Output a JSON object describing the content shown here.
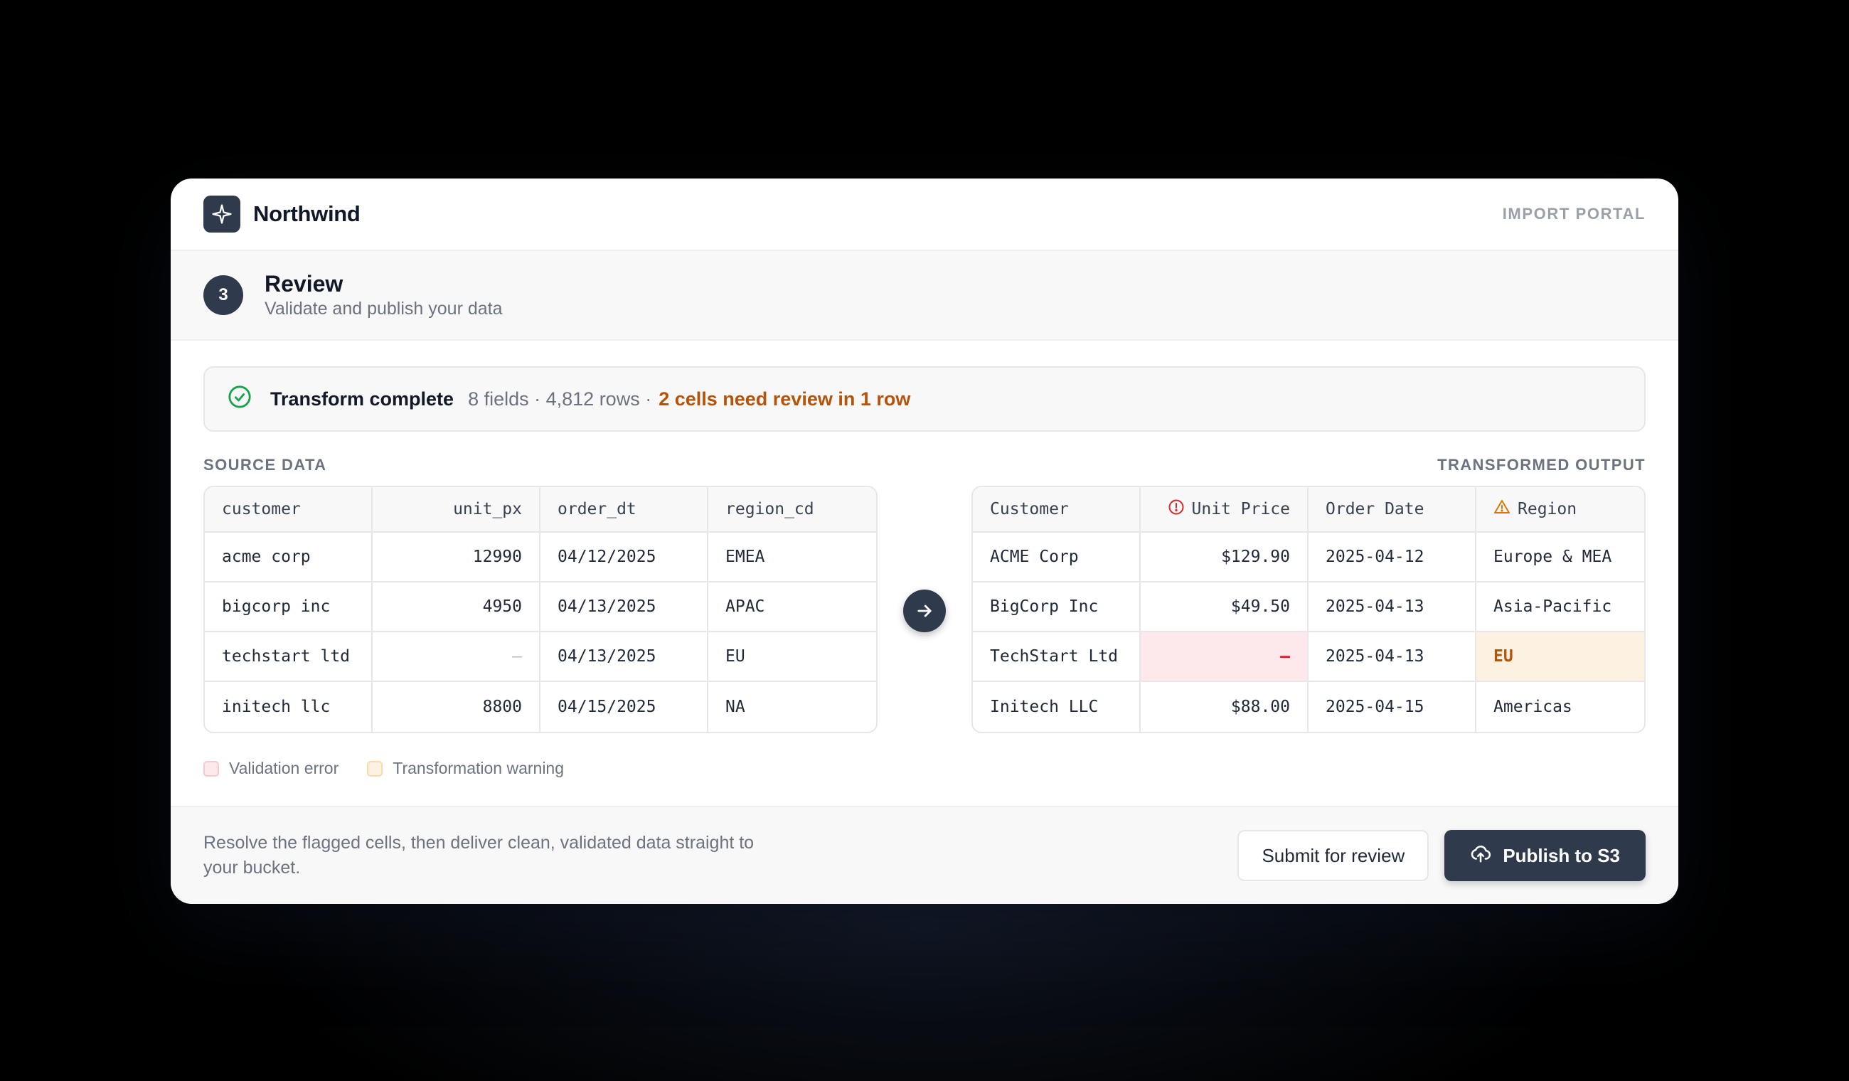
{
  "header": {
    "brand": "Northwind",
    "portal_label": "IMPORT PORTAL"
  },
  "step": {
    "number": "3",
    "title": "Review",
    "subtitle": "Validate and publish your data"
  },
  "status": {
    "title": "Transform complete",
    "meta": "8 fields · 4,812 rows ·",
    "warning": "2 cells need review in 1 row"
  },
  "sections": {
    "source_label": "SOURCE DATA",
    "output_label": "TRANSFORMED OUTPUT"
  },
  "source_table": {
    "headers": [
      "customer",
      "unit_px",
      "order_dt",
      "region_cd"
    ],
    "rows": [
      [
        "acme corp",
        "12990",
        "04/12/2025",
        "EMEA"
      ],
      [
        "bigcorp inc",
        "4950",
        "04/13/2025",
        "APAC"
      ],
      [
        "techstart ltd",
        "–",
        "04/13/2025",
        "EU"
      ],
      [
        "initech llc",
        "8800",
        "04/15/2025",
        "NA"
      ]
    ]
  },
  "output_table": {
    "headers": [
      "Customer",
      "Unit Price",
      "Order Date",
      "Region"
    ],
    "header_icons": [
      "",
      "error-circle-icon",
      "",
      "warning-triangle-icon"
    ],
    "rows": [
      [
        "ACME Corp",
        "$129.90",
        "2025-04-12",
        "Europe & MEA"
      ],
      [
        "BigCorp Inc",
        "$49.50",
        "2025-04-13",
        "Asia-Pacific"
      ],
      [
        "TechStart Ltd",
        "—",
        "2025-04-13",
        "EU"
      ],
      [
        "Initech LLC",
        "$88.00",
        "2025-04-15",
        "Americas"
      ]
    ]
  },
  "legend": {
    "error": "Validation error",
    "warning": "Transformation warning"
  },
  "footer": {
    "text": "Resolve the flagged cells, then deliver clean, validated data straight to your bucket.",
    "secondary_button": "Submit for review",
    "primary_button": "Publish to S3"
  },
  "colors": {
    "primary": "#2f3a4d",
    "error_bg": "#fde8ec",
    "error_text": "#dc2626",
    "warning_bg": "#fdf1e1",
    "warning_text": "#b45309",
    "success": "#16a34a"
  }
}
